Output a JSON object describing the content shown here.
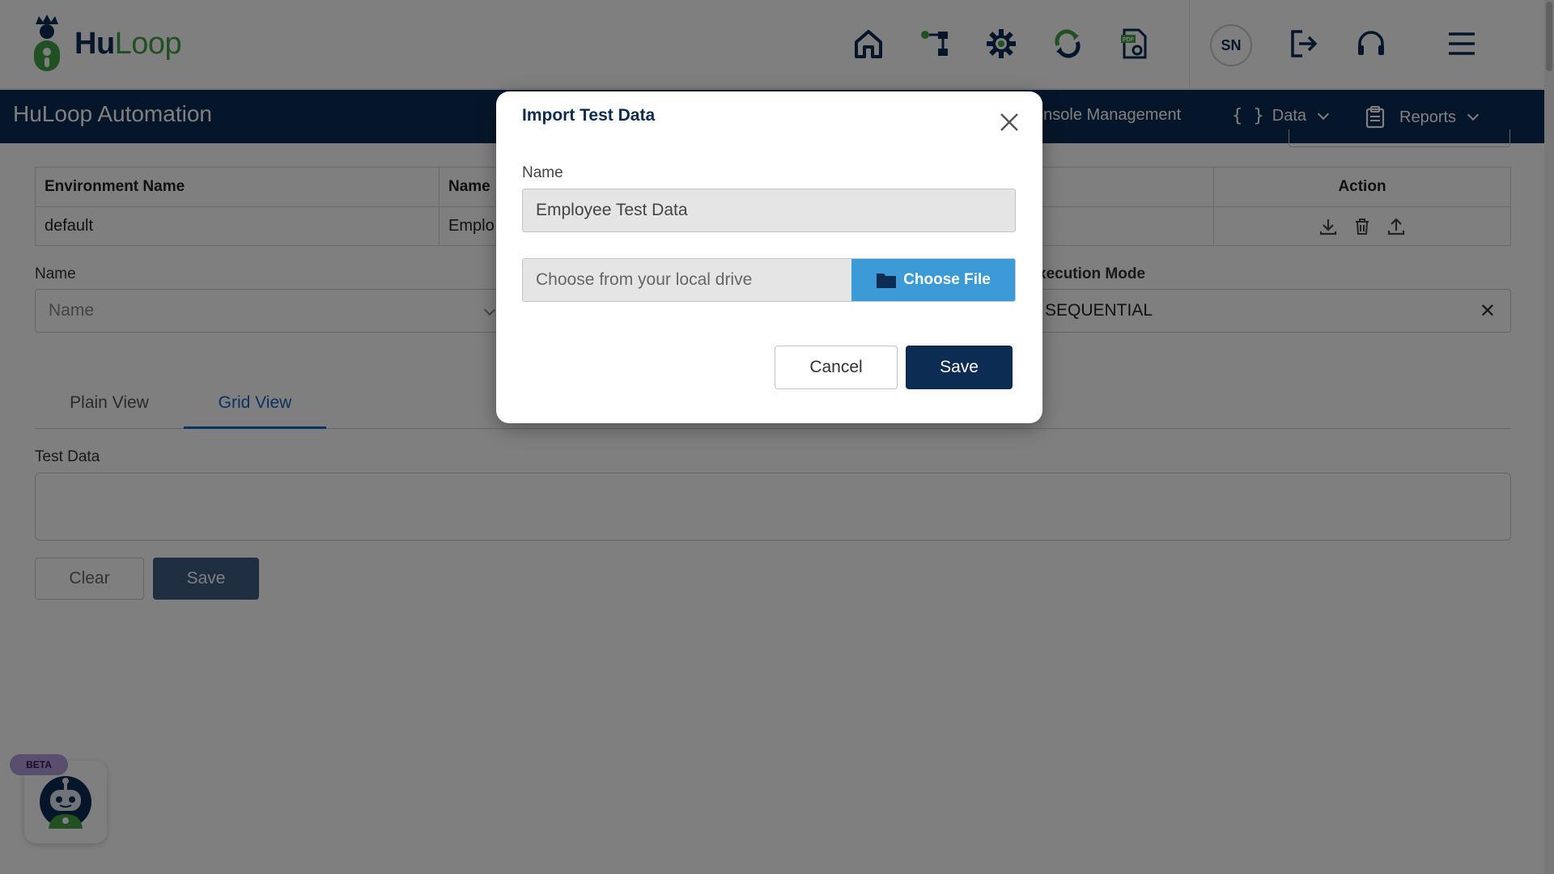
{
  "header": {
    "logo_text_hu": "Hu",
    "logo_text_loop": "Loop",
    "icons": [
      "home-icon",
      "workflow-icon",
      "automation-gear-icon",
      "sync-icon",
      "pdf-settings-icon"
    ],
    "avatar_initials": "SN",
    "right_icons": [
      "logout-icon",
      "headset-icon",
      "menu-icon"
    ]
  },
  "navbar": {
    "app_title": "HuLoop Automation",
    "items": [
      {
        "label": "Console Management",
        "icon": ""
      },
      {
        "label": "Data",
        "icon": "braces-icon",
        "dropdown": true
      },
      {
        "label": "Reports",
        "icon": "clipboard-icon",
        "dropdown": true
      }
    ],
    "console_partial": "onsole Management"
  },
  "table": {
    "headers": [
      "Environment Name",
      "Name",
      "Action"
    ],
    "rows": [
      {
        "environment": "default",
        "name": "Emplo"
      }
    ],
    "action_icons": [
      "download-icon",
      "trash-icon",
      "upload-icon"
    ]
  },
  "form": {
    "name_label": "Name",
    "name_placeholder": "Name",
    "execution_mode_label": "xecution Mode",
    "execution_mode_value": "SEQUENTIAL"
  },
  "tabs": [
    {
      "label": "Plain View",
      "active": false
    },
    {
      "label": "Grid View",
      "active": true
    }
  ],
  "test_data": {
    "label": "Test Data",
    "value": ""
  },
  "page_buttons": {
    "clear": "Clear",
    "save": "Save"
  },
  "beta": {
    "badge": "BETA"
  },
  "modal": {
    "title": "Import Test Data",
    "name_label": "Name",
    "name_value": "Employee Test Data",
    "file_placeholder": "Choose from your local drive",
    "choose_file_label": "Choose File",
    "cancel_label": "Cancel",
    "save_label": "Save"
  },
  "colors": {
    "navy": "#0d2c54",
    "accent_green": "#43a047",
    "choose_file_blue": "#3c9ad6",
    "active_tab_blue": "#1565c0"
  }
}
